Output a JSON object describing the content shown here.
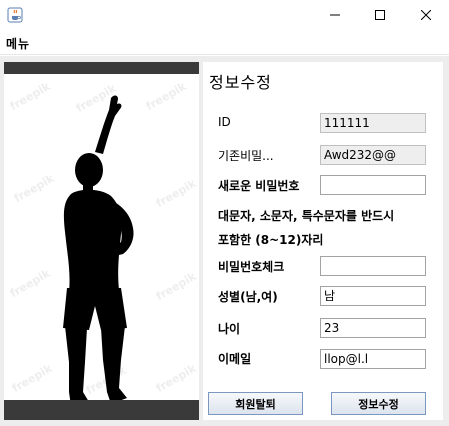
{
  "window": {
    "app_icon": "java-cup-icon",
    "controls": [
      "minimize-icon",
      "maximize-icon",
      "close-icon"
    ]
  },
  "menu": {
    "label": "메뉴"
  },
  "image": {
    "description_icon": "stretching-person-silhouette",
    "watermark": "freepik"
  },
  "form": {
    "title": "정보수정",
    "id_label": "ID",
    "id_value": "111111",
    "old_pw_label": "기존비밀...",
    "old_pw_value": "Awd232@@",
    "new_pw_label": "새로운 비밀번호",
    "new_pw_value": "",
    "hint_line1": "대문자, 소문자, 특수문자를 반드시",
    "hint_line2": "포함한 (8~12)자리",
    "pw_check_label": "비밀번호체크",
    "pw_check_value": "",
    "gender_label": "성별(남,여)",
    "gender_value": "남",
    "age_label": "나이",
    "age_value": "23",
    "email_label": "이메일",
    "email_value": "llop@l.l"
  },
  "buttons": {
    "withdraw": "회원탈퇴",
    "update": "정보수정"
  }
}
